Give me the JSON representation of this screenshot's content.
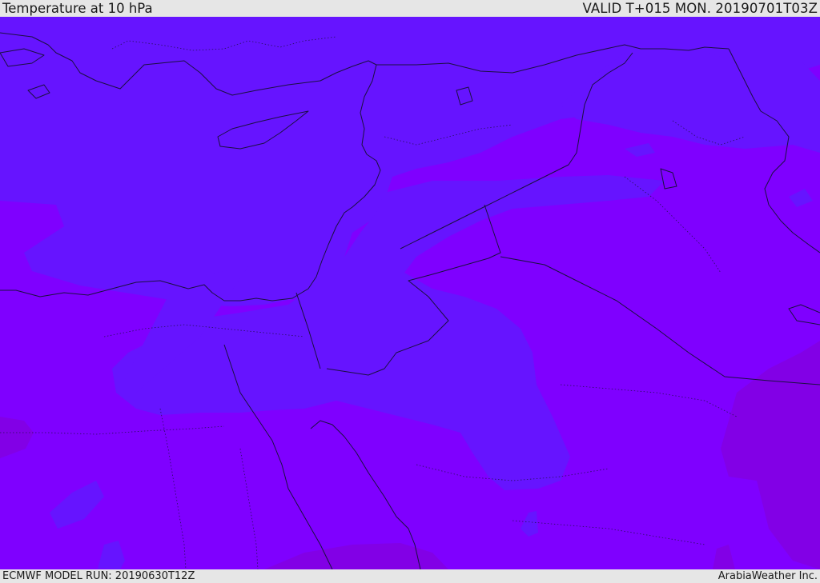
{
  "header": {
    "title": "Temperature at 10 hPa",
    "valid": "VALID T+015 MON. 20190701T03Z"
  },
  "footer": {
    "model_run": "ECMWF MODEL RUN: 20190630T12Z",
    "brand": "ArabiaWeather Inc."
  },
  "map": {
    "background_color": "#7f00ff",
    "cool_region_color": "#6614ff",
    "warm_region_color": "#8000e8",
    "border_color": "#1b1040"
  }
}
